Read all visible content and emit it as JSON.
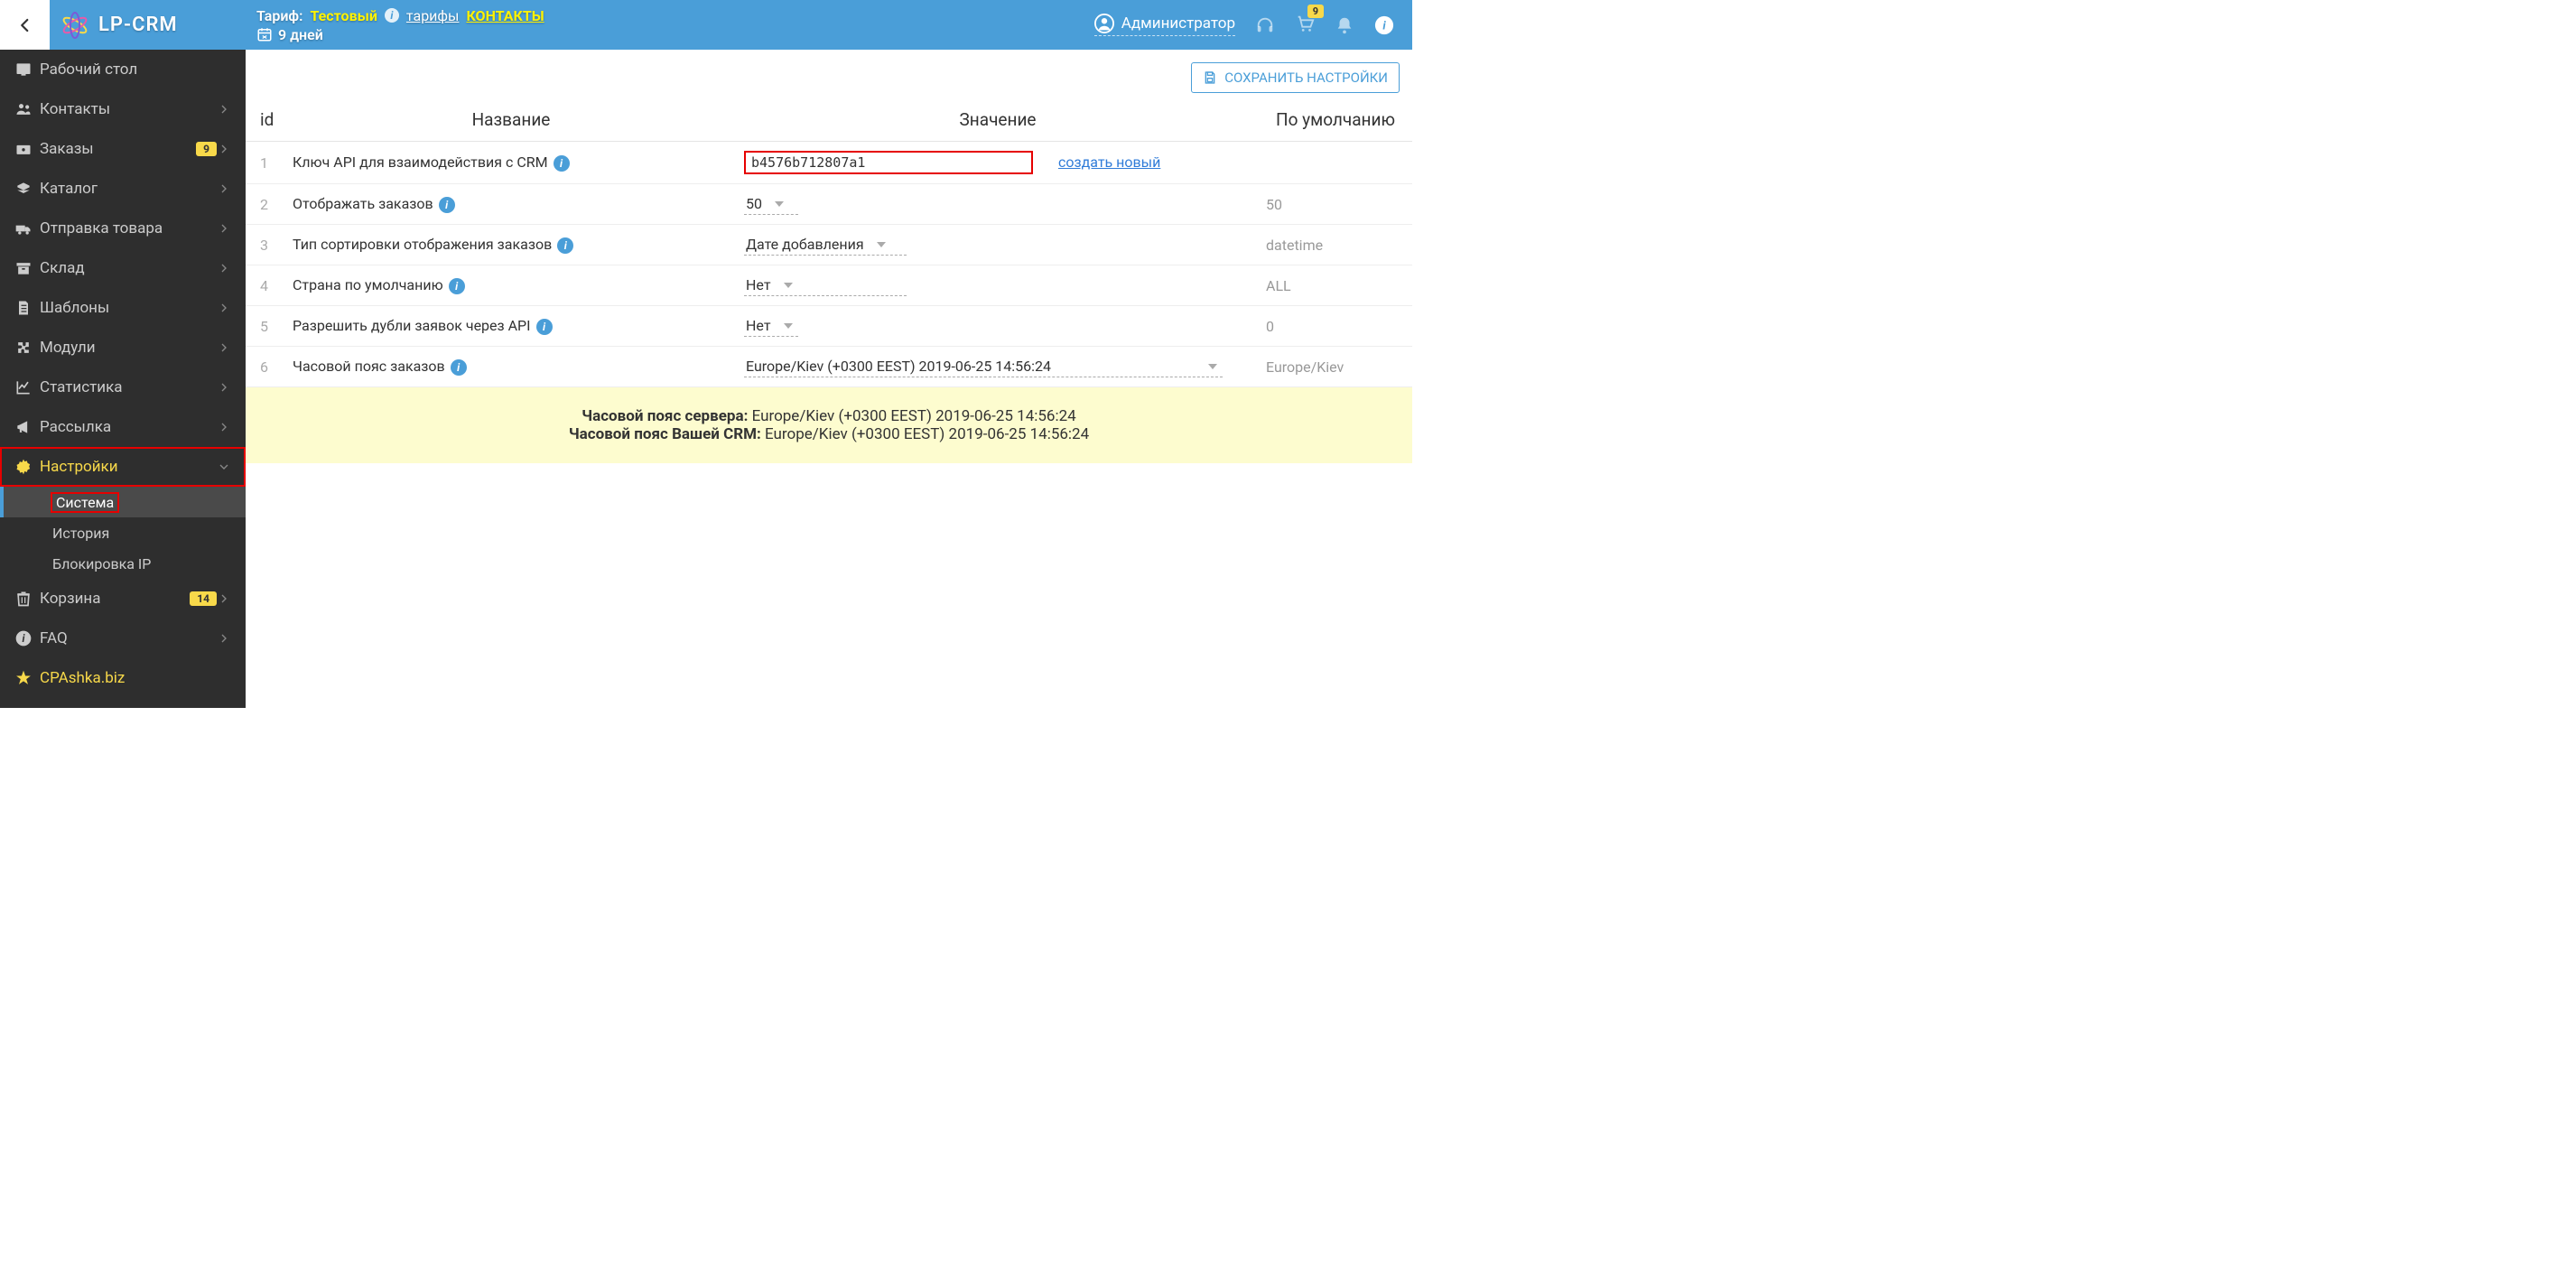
{
  "brand": "LP-CRM",
  "topbar": {
    "tariff_label": "Тариф:",
    "tariff_value": "Тестовый",
    "tariffs_link": "тарифы",
    "contacts_link": "КОНТАКТЫ",
    "days": "9 дней",
    "user": "Администратор",
    "cart_badge": "9"
  },
  "sidebar": {
    "items": [
      {
        "label": "Рабочий стол"
      },
      {
        "label": "Контакты"
      },
      {
        "label": "Заказы",
        "badge": "9"
      },
      {
        "label": "Каталог"
      },
      {
        "label": "Отправка товара"
      },
      {
        "label": "Склад"
      },
      {
        "label": "Шаблоны"
      },
      {
        "label": "Модули"
      },
      {
        "label": "Статистика"
      },
      {
        "label": "Рассылка"
      },
      {
        "label": "Настройки"
      },
      {
        "label": "Корзина",
        "badge": "14"
      },
      {
        "label": "FAQ"
      },
      {
        "label": "CPAshka.biz"
      }
    ],
    "sub": [
      {
        "label": "Система"
      },
      {
        "label": "История"
      },
      {
        "label": "Блокировка IP"
      }
    ]
  },
  "save_button": "СОХРАНИТЬ НАСТРОЙКИ",
  "table": {
    "headers": {
      "id": "id",
      "name": "Название",
      "value": "Значение",
      "default": "По умолчанию"
    },
    "rows": [
      {
        "id": "1",
        "name": "Ключ API для взаимодействия с CRM",
        "value": "b4576b712807a1",
        "link": "создать новый",
        "default": ""
      },
      {
        "id": "2",
        "name": "Отображать заказов",
        "value": "50",
        "default": "50"
      },
      {
        "id": "3",
        "name": "Тип сортировки отображения заказов",
        "value": "Дате добавления",
        "default": "datetime"
      },
      {
        "id": "4",
        "name": "Страна по умолчанию",
        "value": "Нет",
        "default": "ALL"
      },
      {
        "id": "5",
        "name": "Разрешить дубли заявок через API",
        "value": "Нет",
        "default": "0"
      },
      {
        "id": "6",
        "name": "Часовой пояс заказов",
        "value": "Europe/Kiev (+0300 EEST) 2019-06-25 14:56:24",
        "default": "Europe/Kiev"
      }
    ]
  },
  "tz": {
    "server_label": "Часовой пояс сервера:",
    "server_value": "Europe/Kiev (+0300 EEST) 2019-06-25 14:56:24",
    "crm_label": "Часовой пояс Вашей CRM:",
    "crm_value": "Europe/Kiev (+0300 EEST) 2019-06-25 14:56:24"
  }
}
